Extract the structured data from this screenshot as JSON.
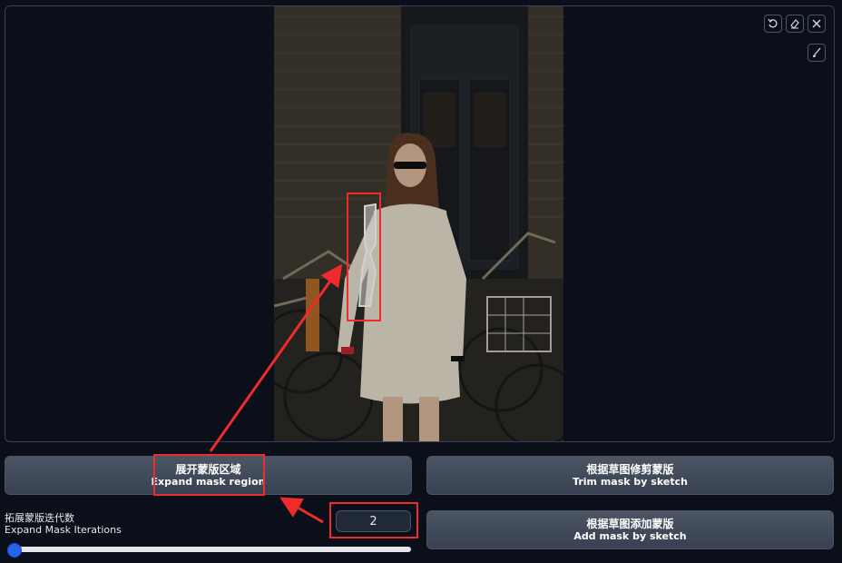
{
  "canvas": {
    "toolbar": {
      "undo": "undo-icon",
      "erase": "eraser-icon",
      "close": "close-icon",
      "brush": "brush-icon"
    }
  },
  "buttons": {
    "expand": {
      "zh": "展开蒙版区域",
      "en": "Expand mask region"
    },
    "trim": {
      "zh": "根据草图修剪蒙版",
      "en": "Trim mask by sketch"
    },
    "add": {
      "zh": "根据草图添加蒙版",
      "en": "Add mask by sketch"
    }
  },
  "iterations": {
    "label_zh": "拓展蒙版迭代数",
    "label_en": "Expand Mask Iterations",
    "value": "2",
    "slider_fraction": 0.0
  },
  "colors": {
    "accent": "#2563eb",
    "annotation": "#ef2b2b",
    "button": "#4b5563",
    "background": "#0b0f19"
  }
}
